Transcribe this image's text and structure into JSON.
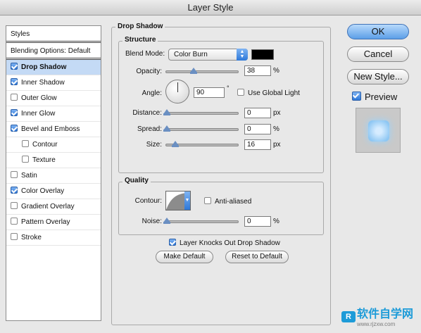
{
  "window": {
    "title": "Layer Style"
  },
  "sidebar": {
    "header": "Styles",
    "blending": "Blending Options: Default",
    "items": [
      {
        "label": "Drop Shadow",
        "checked": true,
        "selected": true
      },
      {
        "label": "Inner Shadow",
        "checked": true
      },
      {
        "label": "Outer Glow",
        "checked": false
      },
      {
        "label": "Inner Glow",
        "checked": true
      },
      {
        "label": "Bevel and Emboss",
        "checked": true
      },
      {
        "label": "Contour",
        "checked": false,
        "indent": true
      },
      {
        "label": "Texture",
        "checked": false,
        "indent": true
      },
      {
        "label": "Satin",
        "checked": false
      },
      {
        "label": "Color Overlay",
        "checked": true
      },
      {
        "label": "Gradient Overlay",
        "checked": false
      },
      {
        "label": "Pattern Overlay",
        "checked": false
      },
      {
        "label": "Stroke",
        "checked": false
      }
    ]
  },
  "panel": {
    "section_title": "Drop Shadow",
    "structure": {
      "title": "Structure",
      "blend_mode_label": "Blend Mode:",
      "blend_mode_value": "Color Burn",
      "shadow_color": "#000000",
      "opacity_label": "Opacity:",
      "opacity_value": "38",
      "opacity_unit": "%",
      "angle_label": "Angle:",
      "angle_value": "90",
      "angle_unit": "°",
      "use_global_light_label": "Use Global Light",
      "use_global_light": false,
      "distance_label": "Distance:",
      "distance_value": "0",
      "distance_unit": "px",
      "spread_label": "Spread:",
      "spread_value": "0",
      "spread_unit": "%",
      "size_label": "Size:",
      "size_value": "16",
      "size_unit": "px"
    },
    "quality": {
      "title": "Quality",
      "contour_label": "Contour:",
      "anti_aliased_label": "Anti-aliased",
      "anti_aliased": false,
      "noise_label": "Noise:",
      "noise_value": "0",
      "noise_unit": "%"
    },
    "knockout_label": "Layer Knocks Out Drop Shadow",
    "knockout": true,
    "make_default": "Make Default",
    "reset_default": "Reset to Default"
  },
  "actions": {
    "ok": "OK",
    "cancel": "Cancel",
    "new_style": "New Style...",
    "preview_label": "Preview",
    "preview_checked": true
  },
  "watermark": {
    "text": "软件自学网",
    "url": "www.rjzxw.com"
  },
  "colors": {
    "selection": "#c4daf5",
    "accent": "#2e78d9",
    "preview_glow": "#9ad4ff"
  }
}
